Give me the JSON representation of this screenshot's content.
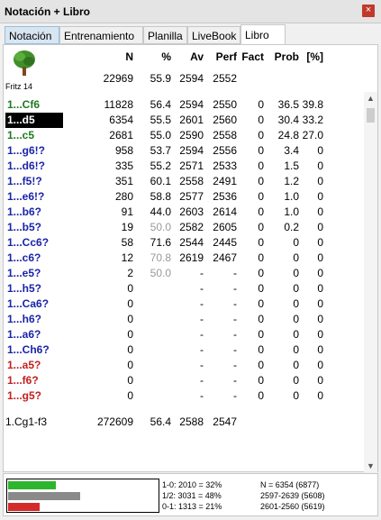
{
  "window": {
    "title": "Notación + Libro",
    "close_glyph": "×"
  },
  "tabs": [
    "Notación",
    "Entrenamiento",
    "Planilla",
    "LiveBook",
    "Libro"
  ],
  "active_tab": "Libro",
  "engine": {
    "name": "Fritz 14",
    "icon": "tree-icon"
  },
  "headers": {
    "n": "N",
    "pct": "%",
    "av": "Av",
    "perf": "Perf",
    "fact": "Fact",
    "prob": "Prob",
    "brk": "[%]"
  },
  "summary": {
    "n": "22969",
    "pct": "55.9",
    "av": "2594",
    "perf": "2552"
  },
  "moves": [
    {
      "move": "1...Cf6",
      "color": "green",
      "n": "11828",
      "pct": "56.4",
      "av": "2594",
      "perf": "2550",
      "fact": "0",
      "prob": "36.5",
      "brk": "39.8"
    },
    {
      "move": "1...d5",
      "color": "selected",
      "n": "6354",
      "pct": "55.5",
      "av": "2601",
      "perf": "2560",
      "fact": "0",
      "prob": "30.4",
      "brk": "33.2"
    },
    {
      "move": "1...c5",
      "color": "green",
      "n": "2681",
      "pct": "55.0",
      "av": "2590",
      "perf": "2558",
      "fact": "0",
      "prob": "24.8",
      "brk": "27.0"
    },
    {
      "move": "1...g6!?",
      "color": "blue",
      "n": "958",
      "pct": "53.7",
      "av": "2594",
      "perf": "2556",
      "fact": "0",
      "prob": "3.4",
      "brk": "0"
    },
    {
      "move": "1...d6!?",
      "color": "blue",
      "n": "335",
      "pct": "55.2",
      "av": "2571",
      "perf": "2533",
      "fact": "0",
      "prob": "1.5",
      "brk": "0"
    },
    {
      "move": "1...f5!?",
      "color": "blue",
      "n": "351",
      "pct": "60.1",
      "av": "2558",
      "perf": "2491",
      "fact": "0",
      "prob": "1.2",
      "brk": "0"
    },
    {
      "move": "1...e6!?",
      "color": "blue",
      "n": "280",
      "pct": "58.8",
      "av": "2577",
      "perf": "2536",
      "fact": "0",
      "prob": "1.0",
      "brk": "0"
    },
    {
      "move": "1...b6?",
      "color": "blue",
      "n": "91",
      "pct": "44.0",
      "av": "2603",
      "perf": "2614",
      "fact": "0",
      "prob": "1.0",
      "brk": "0"
    },
    {
      "move": "1...b5?",
      "color": "blue",
      "n": "19",
      "pct": "50.0",
      "pct_grey": true,
      "av": "2582",
      "perf": "2605",
      "fact": "0",
      "prob": "0.2",
      "brk": "0"
    },
    {
      "move": "1...Cc6?",
      "color": "blue",
      "n": "58",
      "pct": "71.6",
      "av": "2544",
      "perf": "2445",
      "fact": "0",
      "prob": "0",
      "brk": "0"
    },
    {
      "move": "1...c6?",
      "color": "blue",
      "n": "12",
      "pct": "70.8",
      "pct_grey": true,
      "av": "2619",
      "perf": "2467",
      "fact": "0",
      "prob": "0",
      "brk": "0"
    },
    {
      "move": "1...e5?",
      "color": "blue",
      "n": "2",
      "pct": "50.0",
      "pct_grey": true,
      "av": "-",
      "perf": "-",
      "fact": "0",
      "prob": "0",
      "brk": "0"
    },
    {
      "move": "1...h5?",
      "color": "blue",
      "n": "0",
      "pct": "",
      "av": "-",
      "perf": "-",
      "fact": "0",
      "prob": "0",
      "brk": "0"
    },
    {
      "move": "1...Ca6?",
      "color": "blue",
      "n": "0",
      "pct": "",
      "av": "-",
      "perf": "-",
      "fact": "0",
      "prob": "0",
      "brk": "0"
    },
    {
      "move": "1...h6?",
      "color": "blue",
      "n": "0",
      "pct": "",
      "av": "-",
      "perf": "-",
      "fact": "0",
      "prob": "0",
      "brk": "0"
    },
    {
      "move": "1...a6?",
      "color": "blue",
      "n": "0",
      "pct": "",
      "av": "-",
      "perf": "-",
      "fact": "0",
      "prob": "0",
      "brk": "0"
    },
    {
      "move": "1...Ch6?",
      "color": "blue",
      "n": "0",
      "pct": "",
      "av": "-",
      "perf": "-",
      "fact": "0",
      "prob": "0",
      "brk": "0"
    },
    {
      "move": "1...a5?",
      "color": "red",
      "n": "0",
      "pct": "",
      "av": "-",
      "perf": "-",
      "fact": "0",
      "prob": "0",
      "brk": "0"
    },
    {
      "move": "1...f6?",
      "color": "red",
      "n": "0",
      "pct": "",
      "av": "-",
      "perf": "-",
      "fact": "0",
      "prob": "0",
      "brk": "0"
    },
    {
      "move": "1...g5?",
      "color": "red",
      "n": "0",
      "pct": "",
      "av": "-",
      "perf": "-",
      "fact": "0",
      "prob": "0",
      "brk": "0"
    }
  ],
  "totals": {
    "label": "1.Cg1-f3",
    "n": "272609",
    "pct": "56.4",
    "av": "2588",
    "perf": "2547"
  },
  "results": {
    "bars": [
      {
        "label": "1-0",
        "fraction": 0.32,
        "color": "#2db52d"
      },
      {
        "label": "1/2",
        "fraction": 0.48,
        "color": "#8a8a8a"
      },
      {
        "label": "0-1",
        "fraction": 0.21,
        "color": "#d42a2a"
      }
    ],
    "lines_left": [
      "1-0: 2010 = 32%",
      "1/2: 3031 = 48%",
      "0-1: 1313 = 21%"
    ],
    "lines_right": [
      "N = 6354 (6877)",
      "2597-2639 (5608)",
      "2601-2560 (5619)"
    ]
  },
  "colors": {
    "green": "#1e7a1e",
    "blue": "#1a24a8",
    "red": "#c41e1e",
    "selected_bg": "#000000"
  }
}
